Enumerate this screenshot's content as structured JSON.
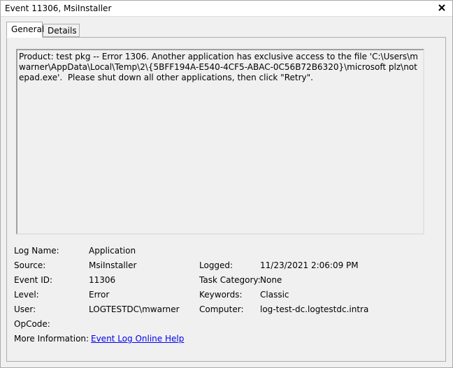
{
  "window": {
    "title": "Event 11306, MsiInstaller"
  },
  "tabs": [
    {
      "label": "General",
      "active": true
    },
    {
      "label": "Details",
      "active": false
    }
  ],
  "general": {
    "message": "Product: test pkg -- Error 1306. Another application has exclusive access to the file 'C:\\Users\\mwarner\\AppData\\Local\\Temp\\2\\{5BFF194A-E540-4CF5-ABAC-0C56B72B6320}\\microsoft plz\\notepad.exe'.  Please shut down all other applications, then click \"Retry\".",
    "fields": {
      "log_name_label": "Log Name:",
      "log_name": "Application",
      "source_label": "Source:",
      "source": "MsiInstaller",
      "logged_label": "Logged:",
      "logged": "11/23/2021 2:06:09 PM",
      "event_id_label": "Event ID:",
      "event_id": "11306",
      "task_category_label": "Task Category:",
      "task_category": "None",
      "level_label": "Level:",
      "level": "Error",
      "keywords_label": "Keywords:",
      "keywords": "Classic",
      "user_label": "User:",
      "user": "LOGTESTDC\\mwarner",
      "computer_label": "Computer:",
      "computer": "log-test-dc.logtestdc.intra",
      "opcode_label": "OpCode:",
      "opcode": "",
      "more_info_label": "More Information:",
      "more_info_link": "Event Log Online Help"
    }
  },
  "icons": {
    "close": "close-icon"
  }
}
